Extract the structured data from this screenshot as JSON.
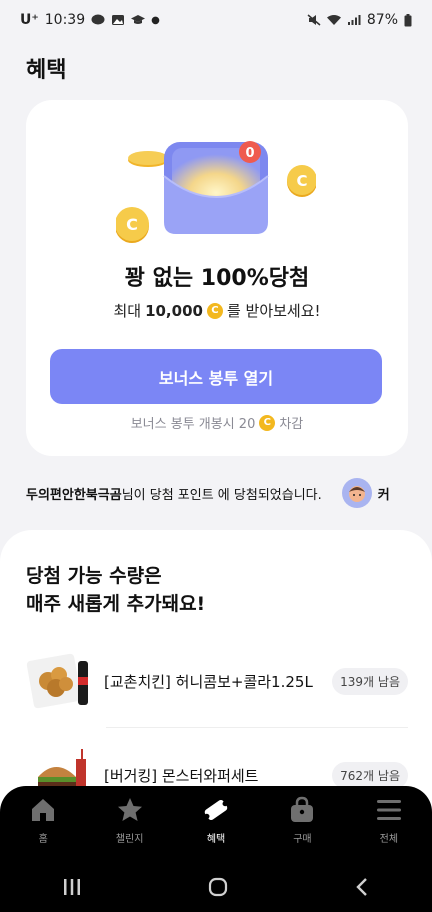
{
  "status_bar": {
    "carrier": "U⁺",
    "time": "10:39",
    "battery": "87%"
  },
  "page": {
    "title": "혜택"
  },
  "bonus_card": {
    "notification_count": "0",
    "headline": "꽝 없는 100%당첨",
    "sub_prefix": "최대",
    "sub_amount": "10,000",
    "sub_suffix": "를 받아보세요!",
    "coin_symbol": "C",
    "button_label": "보너스 봉투 열기",
    "cost_prefix": "보너스 봉투 개봉시 20",
    "cost_suffix": "차감"
  },
  "ticker": {
    "winner": "두의편안한북극곰",
    "message": "님이 당첨 포인트 에 당첨되었습니다.",
    "next_fragment": "커"
  },
  "prizes_section": {
    "title_line1": "당첨 가능 수량은",
    "title_line2": "매주 새롭게 추가돼요!",
    "items": [
      {
        "name": "[교촌치킨] 허니콤보+콜라1.25L",
        "remaining": "139개 남음"
      },
      {
        "name": "[버거킹] 몬스터와퍼세트",
        "remaining": "762개 남음"
      }
    ]
  },
  "tab_bar": {
    "tabs": [
      {
        "label": "홈",
        "icon": "home-icon"
      },
      {
        "label": "챌린지",
        "icon": "star-icon"
      },
      {
        "label": "혜택",
        "icon": "ticket-icon"
      },
      {
        "label": "구매",
        "icon": "shopping-bag-icon"
      },
      {
        "label": "전체",
        "icon": "menu-icon"
      }
    ],
    "active": "혜택"
  },
  "colors": {
    "accent": "#7b86f5",
    "coin": "#f3b81f",
    "badge_red": "#ef5b4f"
  }
}
